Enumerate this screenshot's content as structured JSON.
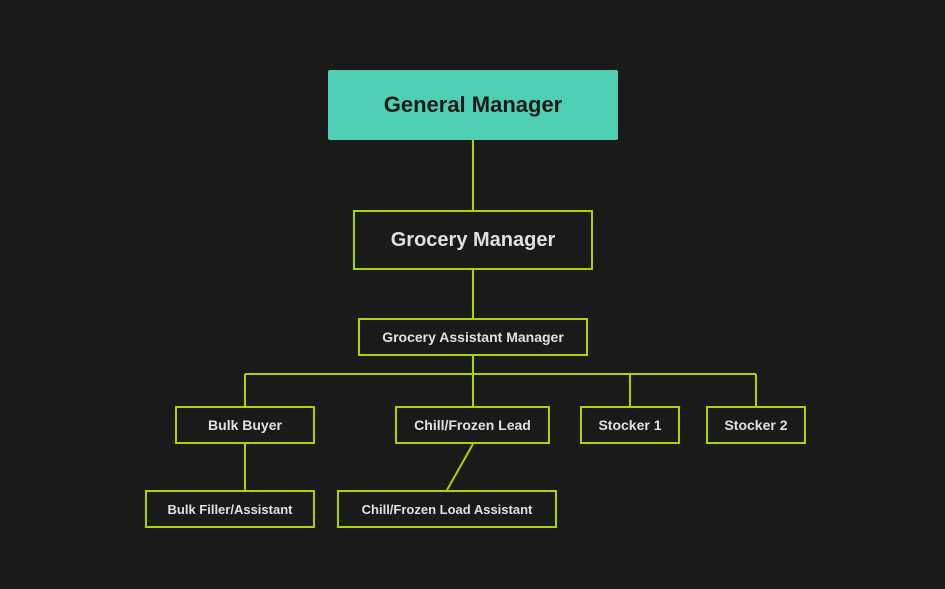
{
  "nodes": {
    "general_manager": {
      "label": "General Manager"
    },
    "grocery_manager": {
      "label": "Grocery Manager"
    },
    "grocery_assistant_manager": {
      "label": "Grocery Assistant Manager"
    },
    "bulk_buyer": {
      "label": "Bulk Buyer"
    },
    "chill_frozen_lead": {
      "label": "Chill/Frozen Lead"
    },
    "stocker_1": {
      "label": "Stocker 1"
    },
    "stocker_2": {
      "label": "Stocker 2"
    },
    "bulk_filler_assistant": {
      "label": "Bulk Filler/Assistant"
    },
    "chill_frozen_load_assistant": {
      "label": "Chill/Frozen Load Assistant"
    }
  },
  "colors": {
    "teal": "#4ecfb3",
    "lime": "#a8d400",
    "background": "#1a1a1a",
    "text_dark": "#1a1a1a",
    "text_light": "#e0e0e0"
  }
}
